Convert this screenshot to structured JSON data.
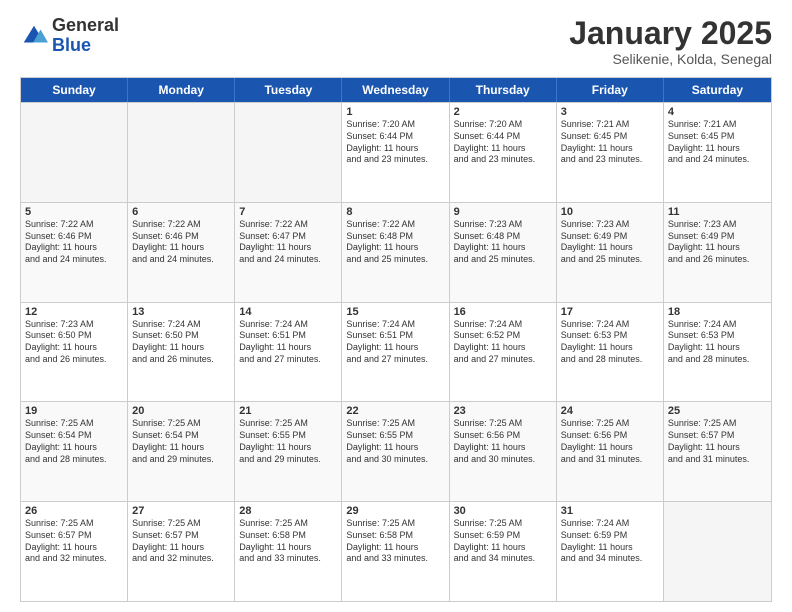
{
  "logo": {
    "general": "General",
    "blue": "Blue"
  },
  "header": {
    "month": "January 2025",
    "location": "Selikenie, Kolda, Senegal"
  },
  "weekdays": [
    "Sunday",
    "Monday",
    "Tuesday",
    "Wednesday",
    "Thursday",
    "Friday",
    "Saturday"
  ],
  "rows": [
    [
      {
        "day": "",
        "empty": true
      },
      {
        "day": "",
        "empty": true
      },
      {
        "day": "",
        "empty": true
      },
      {
        "day": "1",
        "sunrise": "Sunrise: 7:20 AM",
        "sunset": "Sunset: 6:44 PM",
        "daylight": "Daylight: 11 hours and 23 minutes."
      },
      {
        "day": "2",
        "sunrise": "Sunrise: 7:20 AM",
        "sunset": "Sunset: 6:44 PM",
        "daylight": "Daylight: 11 hours and 23 minutes."
      },
      {
        "day": "3",
        "sunrise": "Sunrise: 7:21 AM",
        "sunset": "Sunset: 6:45 PM",
        "daylight": "Daylight: 11 hours and 23 minutes."
      },
      {
        "day": "4",
        "sunrise": "Sunrise: 7:21 AM",
        "sunset": "Sunset: 6:45 PM",
        "daylight": "Daylight: 11 hours and 24 minutes."
      }
    ],
    [
      {
        "day": "5",
        "sunrise": "Sunrise: 7:22 AM",
        "sunset": "Sunset: 6:46 PM",
        "daylight": "Daylight: 11 hours and 24 minutes."
      },
      {
        "day": "6",
        "sunrise": "Sunrise: 7:22 AM",
        "sunset": "Sunset: 6:46 PM",
        "daylight": "Daylight: 11 hours and 24 minutes."
      },
      {
        "day": "7",
        "sunrise": "Sunrise: 7:22 AM",
        "sunset": "Sunset: 6:47 PM",
        "daylight": "Daylight: 11 hours and 24 minutes."
      },
      {
        "day": "8",
        "sunrise": "Sunrise: 7:22 AM",
        "sunset": "Sunset: 6:48 PM",
        "daylight": "Daylight: 11 hours and 25 minutes."
      },
      {
        "day": "9",
        "sunrise": "Sunrise: 7:23 AM",
        "sunset": "Sunset: 6:48 PM",
        "daylight": "Daylight: 11 hours and 25 minutes."
      },
      {
        "day": "10",
        "sunrise": "Sunrise: 7:23 AM",
        "sunset": "Sunset: 6:49 PM",
        "daylight": "Daylight: 11 hours and 25 minutes."
      },
      {
        "day": "11",
        "sunrise": "Sunrise: 7:23 AM",
        "sunset": "Sunset: 6:49 PM",
        "daylight": "Daylight: 11 hours and 26 minutes."
      }
    ],
    [
      {
        "day": "12",
        "sunrise": "Sunrise: 7:23 AM",
        "sunset": "Sunset: 6:50 PM",
        "daylight": "Daylight: 11 hours and 26 minutes."
      },
      {
        "day": "13",
        "sunrise": "Sunrise: 7:24 AM",
        "sunset": "Sunset: 6:50 PM",
        "daylight": "Daylight: 11 hours and 26 minutes."
      },
      {
        "day": "14",
        "sunrise": "Sunrise: 7:24 AM",
        "sunset": "Sunset: 6:51 PM",
        "daylight": "Daylight: 11 hours and 27 minutes."
      },
      {
        "day": "15",
        "sunrise": "Sunrise: 7:24 AM",
        "sunset": "Sunset: 6:51 PM",
        "daylight": "Daylight: 11 hours and 27 minutes."
      },
      {
        "day": "16",
        "sunrise": "Sunrise: 7:24 AM",
        "sunset": "Sunset: 6:52 PM",
        "daylight": "Daylight: 11 hours and 27 minutes."
      },
      {
        "day": "17",
        "sunrise": "Sunrise: 7:24 AM",
        "sunset": "Sunset: 6:53 PM",
        "daylight": "Daylight: 11 hours and 28 minutes."
      },
      {
        "day": "18",
        "sunrise": "Sunrise: 7:24 AM",
        "sunset": "Sunset: 6:53 PM",
        "daylight": "Daylight: 11 hours and 28 minutes."
      }
    ],
    [
      {
        "day": "19",
        "sunrise": "Sunrise: 7:25 AM",
        "sunset": "Sunset: 6:54 PM",
        "daylight": "Daylight: 11 hours and 28 minutes."
      },
      {
        "day": "20",
        "sunrise": "Sunrise: 7:25 AM",
        "sunset": "Sunset: 6:54 PM",
        "daylight": "Daylight: 11 hours and 29 minutes."
      },
      {
        "day": "21",
        "sunrise": "Sunrise: 7:25 AM",
        "sunset": "Sunset: 6:55 PM",
        "daylight": "Daylight: 11 hours and 29 minutes."
      },
      {
        "day": "22",
        "sunrise": "Sunrise: 7:25 AM",
        "sunset": "Sunset: 6:55 PM",
        "daylight": "Daylight: 11 hours and 30 minutes."
      },
      {
        "day": "23",
        "sunrise": "Sunrise: 7:25 AM",
        "sunset": "Sunset: 6:56 PM",
        "daylight": "Daylight: 11 hours and 30 minutes."
      },
      {
        "day": "24",
        "sunrise": "Sunrise: 7:25 AM",
        "sunset": "Sunset: 6:56 PM",
        "daylight": "Daylight: 11 hours and 31 minutes."
      },
      {
        "day": "25",
        "sunrise": "Sunrise: 7:25 AM",
        "sunset": "Sunset: 6:57 PM",
        "daylight": "Daylight: 11 hours and 31 minutes."
      }
    ],
    [
      {
        "day": "26",
        "sunrise": "Sunrise: 7:25 AM",
        "sunset": "Sunset: 6:57 PM",
        "daylight": "Daylight: 11 hours and 32 minutes."
      },
      {
        "day": "27",
        "sunrise": "Sunrise: 7:25 AM",
        "sunset": "Sunset: 6:57 PM",
        "daylight": "Daylight: 11 hours and 32 minutes."
      },
      {
        "day": "28",
        "sunrise": "Sunrise: 7:25 AM",
        "sunset": "Sunset: 6:58 PM",
        "daylight": "Daylight: 11 hours and 33 minutes."
      },
      {
        "day": "29",
        "sunrise": "Sunrise: 7:25 AM",
        "sunset": "Sunset: 6:58 PM",
        "daylight": "Daylight: 11 hours and 33 minutes."
      },
      {
        "day": "30",
        "sunrise": "Sunrise: 7:25 AM",
        "sunset": "Sunset: 6:59 PM",
        "daylight": "Daylight: 11 hours and 34 minutes."
      },
      {
        "day": "31",
        "sunrise": "Sunrise: 7:24 AM",
        "sunset": "Sunset: 6:59 PM",
        "daylight": "Daylight: 11 hours and 34 minutes."
      },
      {
        "day": "",
        "empty": true
      }
    ]
  ]
}
